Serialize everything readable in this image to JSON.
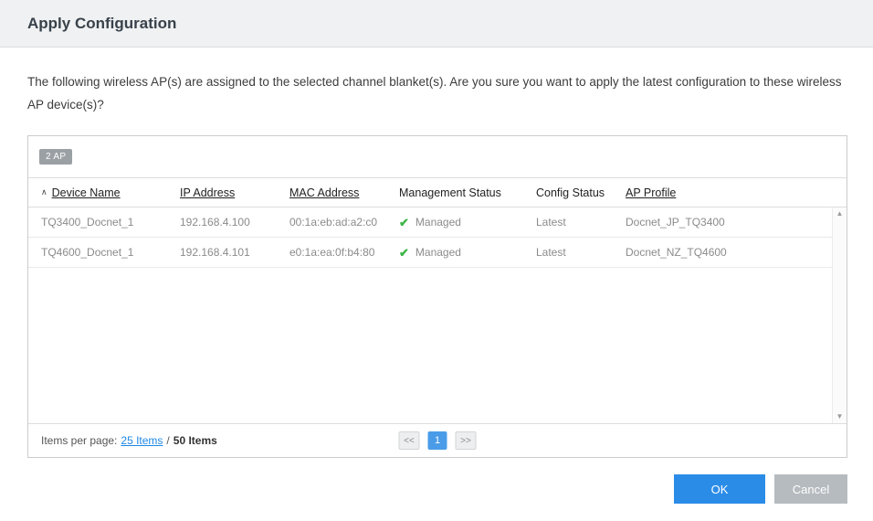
{
  "dialog": {
    "title": "Apply Configuration",
    "message": "The following wireless AP(s) are assigned to the selected channel blanket(s). Are you sure you want to apply the latest configuration to these wireless AP device(s)?"
  },
  "table": {
    "count_badge": "2 AP",
    "sort_icon": "∧",
    "columns": {
      "device_name": "Device Name",
      "ip_address": "IP Address",
      "mac_address": "MAC Address",
      "management_status": "Management Status",
      "config_status": "Config Status",
      "ap_profile": "AP Profile"
    },
    "rows": [
      {
        "device_name": "TQ3400_Docnet_1",
        "ip_address": "192.168.4.100",
        "mac_address": "00:1a:eb:ad:a2:c0",
        "management_check": "✔",
        "management_status": "Managed",
        "config_status": "Latest",
        "ap_profile": "Docnet_JP_TQ3400"
      },
      {
        "device_name": "TQ4600_Docnet_1",
        "ip_address": "192.168.4.101",
        "mac_address": "e0:1a:ea:0f:b4:80",
        "management_check": "✔",
        "management_status": "Managed",
        "config_status": "Latest",
        "ap_profile": "Docnet_NZ_TQ4600"
      }
    ],
    "scrollbar": {
      "up_arrow": "▲",
      "down_arrow": "▼"
    },
    "footer": {
      "items_per_page_label": "Items per page:",
      "items_per_page_link": "25 Items",
      "separator": "/",
      "total_items": "50 Items"
    },
    "pagination": {
      "prev": "<<",
      "current_page": "1",
      "next": ">>"
    }
  },
  "buttons": {
    "ok": "OK",
    "cancel": "Cancel"
  },
  "colors": {
    "accent_blue": "#2b8ce8",
    "pagination_blue": "#4a9ce8",
    "success_green": "#3eb549",
    "header_bg": "#f0f1f2",
    "badge_gray": "#9aa0a4",
    "cancel_gray": "#b6bbbf"
  }
}
